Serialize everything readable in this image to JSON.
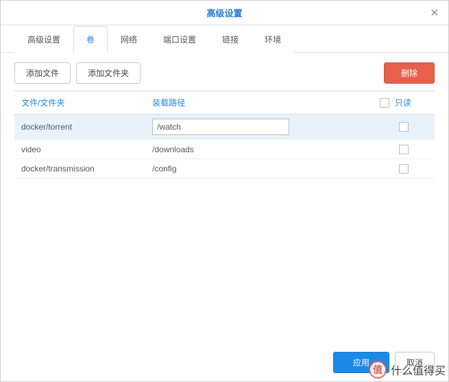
{
  "title": "高级设置",
  "tabs": [
    {
      "label": "高级设置",
      "active": false
    },
    {
      "label": "卷",
      "active": true
    },
    {
      "label": "网络",
      "active": false
    },
    {
      "label": "端口设置",
      "active": false
    },
    {
      "label": "链接",
      "active": false
    },
    {
      "label": "环境",
      "active": false
    }
  ],
  "toolbar": {
    "add_file": "添加文件",
    "add_folder": "添加文件夹",
    "delete": "删除"
  },
  "columns": {
    "file": "文件/文件夹",
    "mount": "装载路径",
    "readonly": "只读"
  },
  "rows": [
    {
      "file": "docker/torrent",
      "mount": "/watch",
      "selected": true,
      "editing": true,
      "readonly": false
    },
    {
      "file": "video",
      "mount": "/downloads",
      "selected": false,
      "editing": false,
      "readonly": false
    },
    {
      "file": "docker/transmission",
      "mount": "/config",
      "selected": false,
      "editing": false,
      "readonly": false
    }
  ],
  "footer": {
    "apply": "应用",
    "cancel": "取消"
  },
  "watermark": {
    "badge": "值",
    "text": "什么值得买"
  }
}
